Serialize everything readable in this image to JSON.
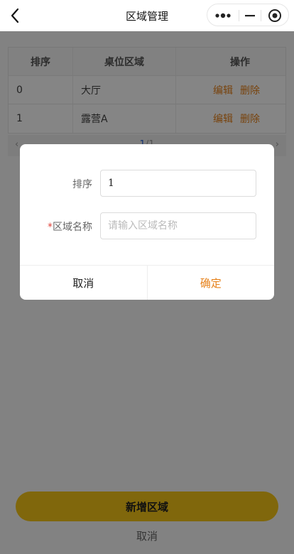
{
  "nav": {
    "title": "区域管理"
  },
  "table": {
    "headers": [
      "排序",
      "桌位区域",
      "操作"
    ],
    "rows": [
      {
        "order": "0",
        "area": "大厅"
      },
      {
        "order": "1",
        "area": "露营A"
      }
    ],
    "edit_label": "编辑",
    "delete_label": "删除"
  },
  "pagination": {
    "current": "1",
    "sep_total": "/1"
  },
  "bottom": {
    "add_label": "新增区域",
    "cancel_label": "取消"
  },
  "modal": {
    "order_label": "排序",
    "order_value": "1",
    "required_mark": "*",
    "name_label": "区域名称",
    "name_placeholder": "请输入区域名称",
    "cancel_label": "取消",
    "confirm_label": "确定"
  },
  "colors": {
    "accent": "#e6811a",
    "button": "#f5c518",
    "required": "#e0443b"
  }
}
